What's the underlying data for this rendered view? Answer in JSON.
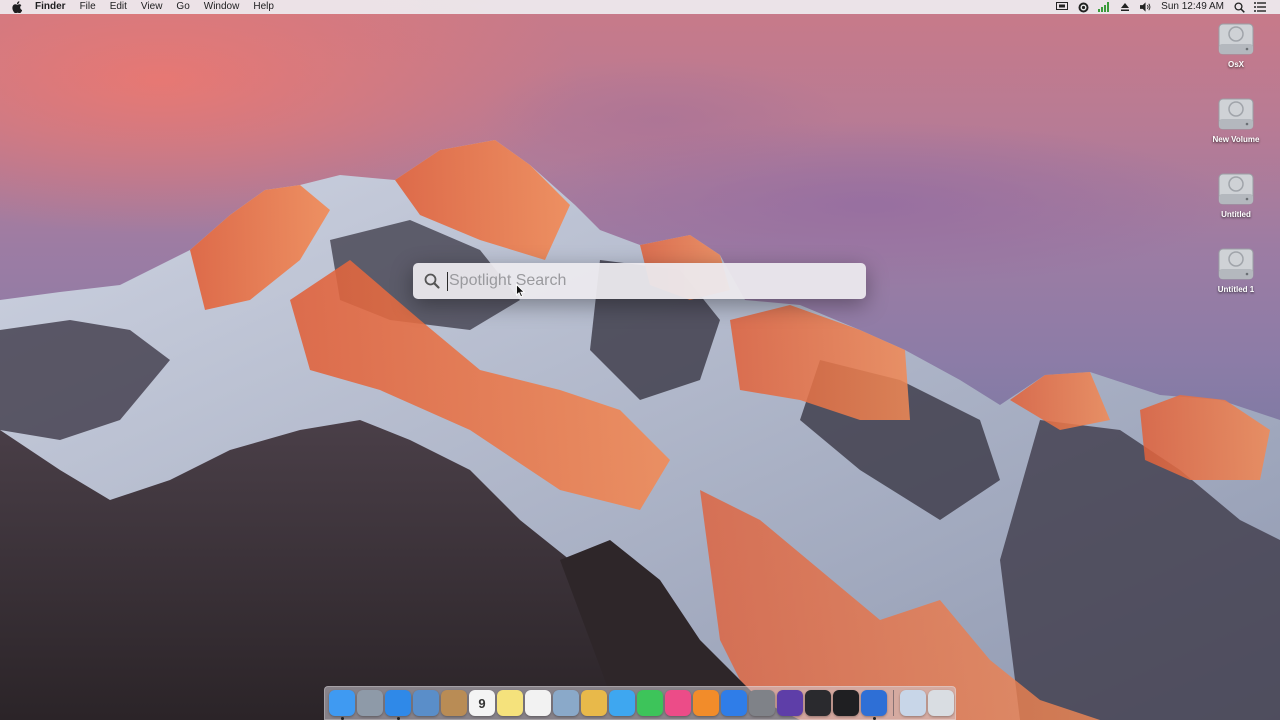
{
  "menubar": {
    "app_name": "Finder",
    "menus": [
      "File",
      "Edit",
      "View",
      "Go",
      "Window",
      "Help"
    ],
    "clock": "Sun 12:49 AM",
    "status_icons": [
      "airplay-icon",
      "creative-cloud-icon",
      "signal-icon",
      "eject-icon",
      "volume-icon",
      "spotlight-search-icon",
      "notification-center-icon"
    ]
  },
  "desktop_icons": [
    {
      "label": "OsX",
      "icon": "hard-drive-icon"
    },
    {
      "label": "New Volume",
      "icon": "hard-drive-icon"
    },
    {
      "label": "Untitled",
      "icon": "hard-drive-icon"
    },
    {
      "label": "Untitled 1",
      "icon": "hard-drive-icon"
    }
  ],
  "spotlight": {
    "placeholder": "Spotlight Search",
    "value": ""
  },
  "dock": {
    "apps": [
      {
        "name": "finder-icon",
        "color": "#3f9af2",
        "running": true
      },
      {
        "name": "launchpad-icon",
        "color": "#8e9aa8",
        "running": false
      },
      {
        "name": "safari-icon",
        "color": "#2f89e8",
        "running": true
      },
      {
        "name": "mail-icon",
        "color": "#5a8ec9",
        "running": false
      },
      {
        "name": "contacts-icon",
        "color": "#b98c55",
        "running": false
      },
      {
        "name": "calendar-icon",
        "color": "#f4f4f4",
        "glyph": "9",
        "running": false
      },
      {
        "name": "notes-icon",
        "color": "#f5e27c",
        "running": false
      },
      {
        "name": "reminders-icon",
        "color": "#f2f2f2",
        "running": false
      },
      {
        "name": "preview-icon",
        "color": "#8aa9c9",
        "running": false
      },
      {
        "name": "photos-icon",
        "color": "#e8b94a",
        "running": false
      },
      {
        "name": "messages-icon",
        "color": "#3ea7f0",
        "running": false
      },
      {
        "name": "facetime-icon",
        "color": "#3dc45a",
        "running": false
      },
      {
        "name": "itunes-icon",
        "color": "#ec4c88",
        "running": false
      },
      {
        "name": "ibooks-icon",
        "color": "#f28c2a",
        "running": false
      },
      {
        "name": "app-store-icon",
        "color": "#2f7de8",
        "running": false
      },
      {
        "name": "system-preferences-icon",
        "color": "#7f8288",
        "running": false
      },
      {
        "name": "imovie-icon",
        "color": "#5e3ea8",
        "running": false
      },
      {
        "name": "logic-pro-icon",
        "color": "#2a2a2e",
        "running": false
      },
      {
        "name": "piano-keys-icon",
        "color": "#1f1f22",
        "running": false
      },
      {
        "name": "xcode-icon",
        "color": "#2e6fd6",
        "running": true
      }
    ],
    "right_items": [
      {
        "name": "downloads-stack-icon",
        "color": "#c8d6e8"
      },
      {
        "name": "trash-icon",
        "color": "#d9dde2"
      }
    ]
  }
}
